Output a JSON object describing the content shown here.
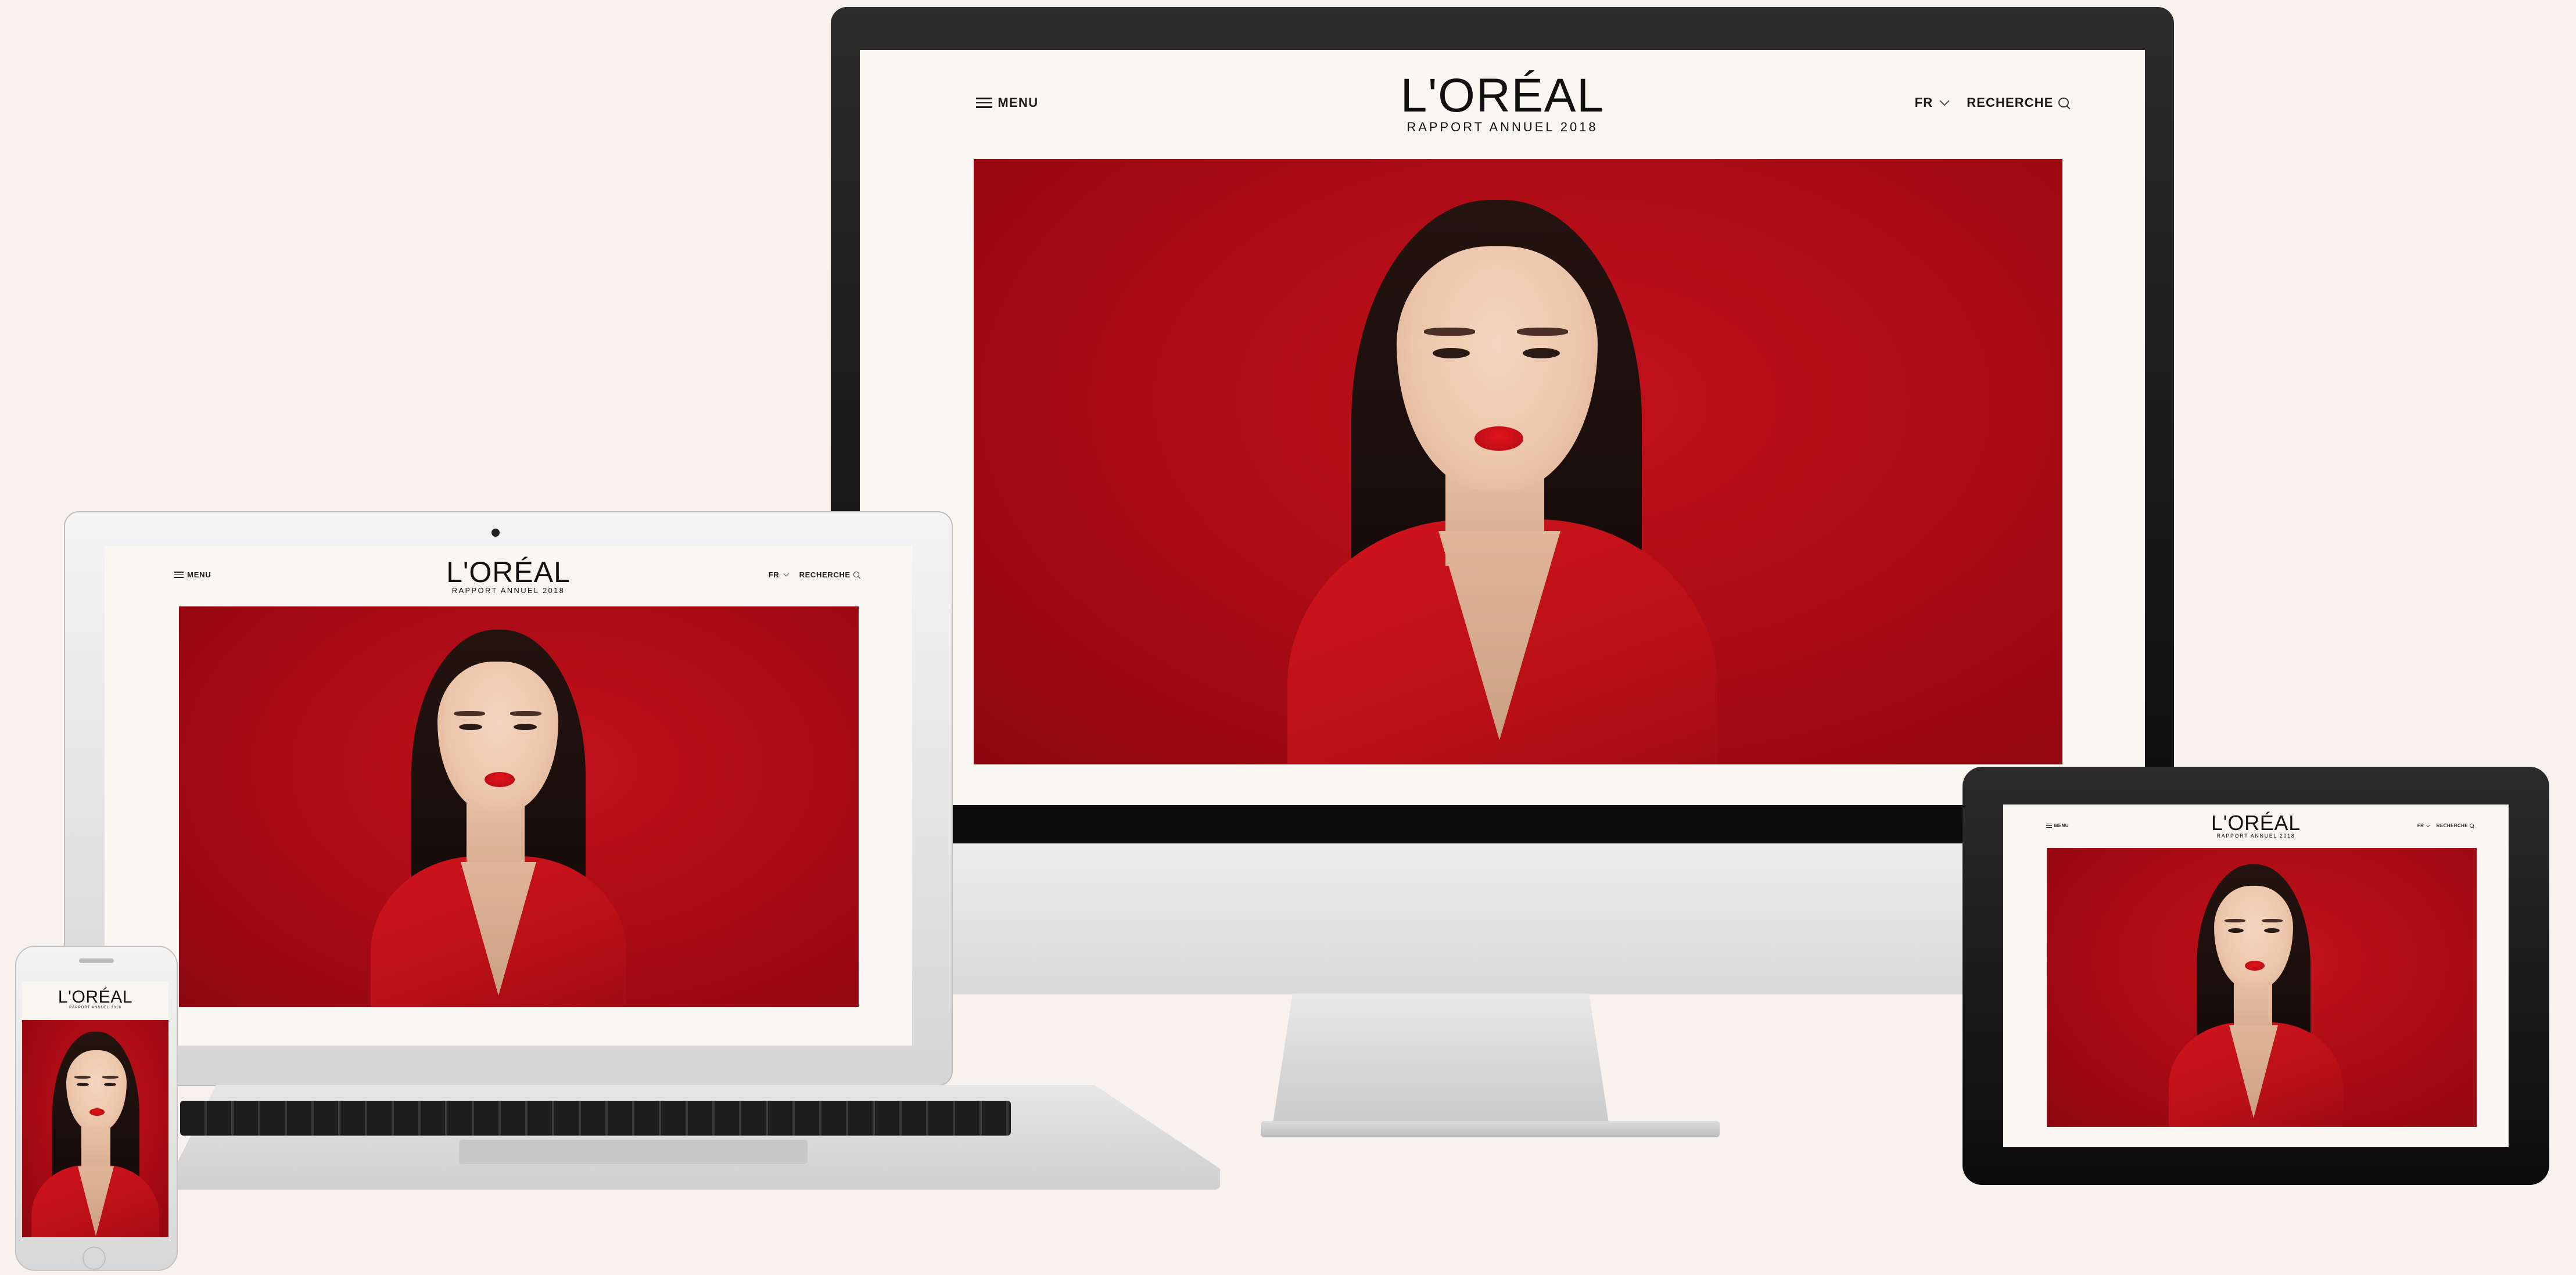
{
  "site": {
    "menu_label": "MENU",
    "logo": "L'ORÉAL",
    "subtitle": "RAPPORT ANNUEL 2018",
    "language": "FR",
    "search_label": "RECHERCHE"
  },
  "devices": [
    "desktop-monitor",
    "laptop",
    "tablet",
    "smartphone"
  ],
  "colors": {
    "background": "#f7f2ee",
    "screen_bg": "#faf6f2",
    "hero_red": "#b10d16",
    "lipstick": "#d4121a"
  },
  "icons": [
    "hamburger-menu-icon",
    "chevron-down-icon",
    "search-icon"
  ]
}
